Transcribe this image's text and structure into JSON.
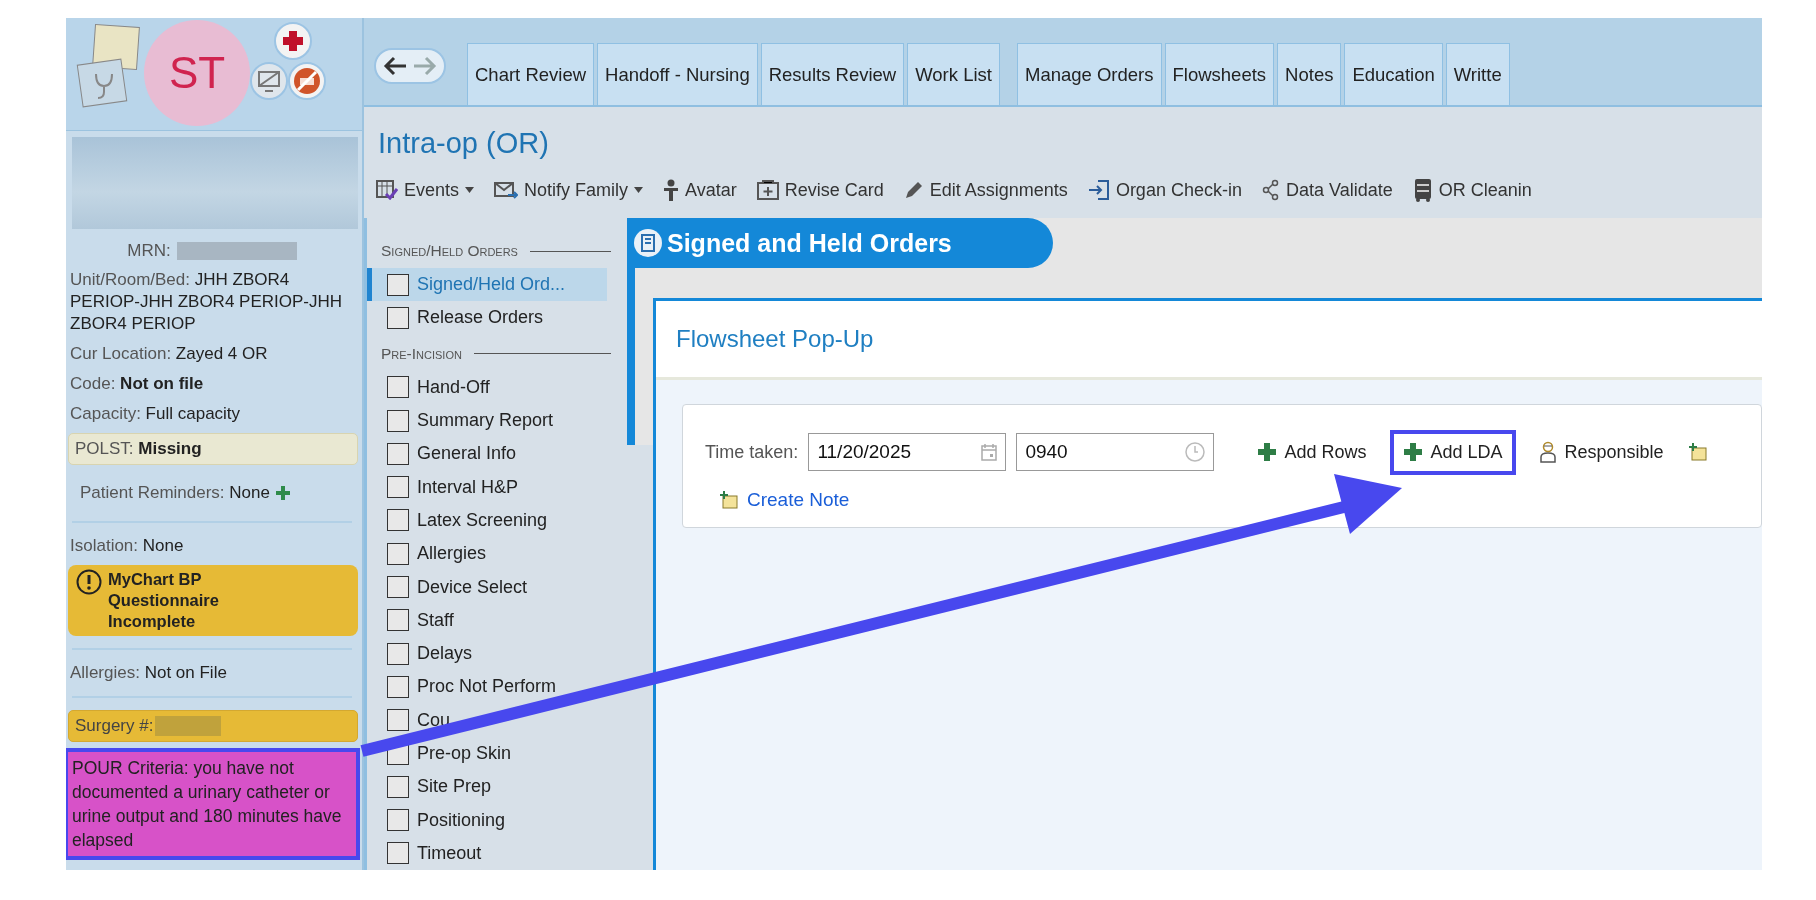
{
  "header": {
    "avatar_initials": "ST"
  },
  "sidebar": {
    "items": [
      {
        "kind": "redacted_block"
      },
      {
        "kind": "redacted_field",
        "label": "MRN:"
      },
      {
        "kind": "field",
        "label": "Unit/Room/Bed:",
        "value": "JHH ZBOR4 PERIOP-JHH ZBOR4 PERIOP-JHH ZBOR4 PERIOP",
        "bold": false
      },
      {
        "kind": "field",
        "label": "Cur Location:",
        "value": "Zayed 4 OR",
        "bold": false
      },
      {
        "kind": "field",
        "label": "Code:",
        "value": "Not on file",
        "bold": true
      },
      {
        "kind": "field",
        "label": "Capacity:",
        "value": "Full capacity",
        "bold": false
      },
      {
        "kind": "banner",
        "label": "POLST:",
        "value": "Missing",
        "color": "#e9e8d2"
      },
      {
        "kind": "reminder",
        "label": "Patient Reminders:",
        "value": "None"
      },
      {
        "kind": "divider"
      },
      {
        "kind": "field",
        "label": "Isolation:",
        "value": "None",
        "bold": false
      },
      {
        "kind": "alert",
        "text": "MyChart BP Questionnaire Incomplete",
        "color": "#e6ba36"
      },
      {
        "kind": "divider"
      },
      {
        "kind": "field",
        "label": "Allergies:",
        "value": "Not on File",
        "bold": false
      },
      {
        "kind": "divider"
      },
      {
        "kind": "redacted_banner",
        "label": "Surgery #:",
        "color": "#e6ba36"
      },
      {
        "kind": "note",
        "text": "POUR Criteria: you have not documented a urinary catheter or urine output and 180 minutes have elapsed",
        "color": "#d752c8",
        "highlighted": true
      }
    ]
  },
  "tabs": [
    {
      "label": "Chart Review"
    },
    {
      "label": "Handoff - Nursing"
    },
    {
      "label": "Results Review"
    },
    {
      "label": "Work List"
    },
    {
      "label": "Manage Orders"
    },
    {
      "label": "Flowsheets"
    },
    {
      "label": "Notes"
    },
    {
      "label": "Education"
    },
    {
      "label": "Writte"
    }
  ],
  "activity": {
    "title": "Intra-op (OR)",
    "toolbar": [
      {
        "label": "Events",
        "kind": "events",
        "menu": true
      },
      {
        "label": "Notify Family",
        "kind": "notify",
        "menu": true
      },
      {
        "label": "Avatar",
        "kind": "avatar",
        "menu": false
      },
      {
        "label": "Revise Card",
        "kind": "revise",
        "menu": false
      },
      {
        "label": "Edit Assignments",
        "kind": "edit",
        "menu": false
      },
      {
        "label": "Organ Check-in",
        "kind": "checkin",
        "menu": false
      },
      {
        "label": "Data Validate",
        "kind": "validate",
        "menu": false
      },
      {
        "label": "OR Cleanin",
        "kind": "cleaning",
        "menu": false
      }
    ]
  },
  "navigator": {
    "sections": [
      {
        "heading": "Signed/Held Orders",
        "items": [
          {
            "label": "Signed/Held Ord...",
            "selected": true
          },
          {
            "label": "Release Orders",
            "selected": false
          }
        ]
      },
      {
        "heading": "Pre-Incision",
        "items": [
          {
            "label": "Hand-Off",
            "selected": false
          },
          {
            "label": "Summary Report",
            "selected": false
          },
          {
            "label": "General Info",
            "selected": false
          },
          {
            "label": "Interval H&P",
            "selected": false
          },
          {
            "label": "Latex Screening",
            "selected": false
          },
          {
            "label": "Allergies",
            "selected": false
          },
          {
            "label": "Device Select",
            "selected": false
          },
          {
            "label": "Staff",
            "selected": false
          },
          {
            "label": "Delays",
            "selected": false
          },
          {
            "label": "Proc Not Perform",
            "selected": false
          },
          {
            "label": "Cou",
            "selected": false
          },
          {
            "label": "Pre-op Skin",
            "selected": false
          },
          {
            "label": "Site Prep",
            "selected": false
          },
          {
            "label": "Positioning",
            "selected": false
          },
          {
            "label": "Timeout",
            "selected": false
          }
        ]
      }
    ]
  },
  "orders_panel": {
    "title": "Signed and Held Orders"
  },
  "popup": {
    "title": "Flowsheet Pop-Up",
    "time_label": "Time taken:",
    "date": {
      "value": "11/20/2025"
    },
    "time": {
      "value": "0940"
    },
    "actions": [
      {
        "label": "Add Rows",
        "kind": "add",
        "highlighted": false
      },
      {
        "label": "Add LDA",
        "kind": "add",
        "highlighted": true
      },
      {
        "label": "Responsible",
        "kind": "responsible",
        "highlighted": false
      }
    ],
    "link": {
      "label": "Create Note"
    }
  },
  "annotation": {
    "kind": "arrow"
  }
}
